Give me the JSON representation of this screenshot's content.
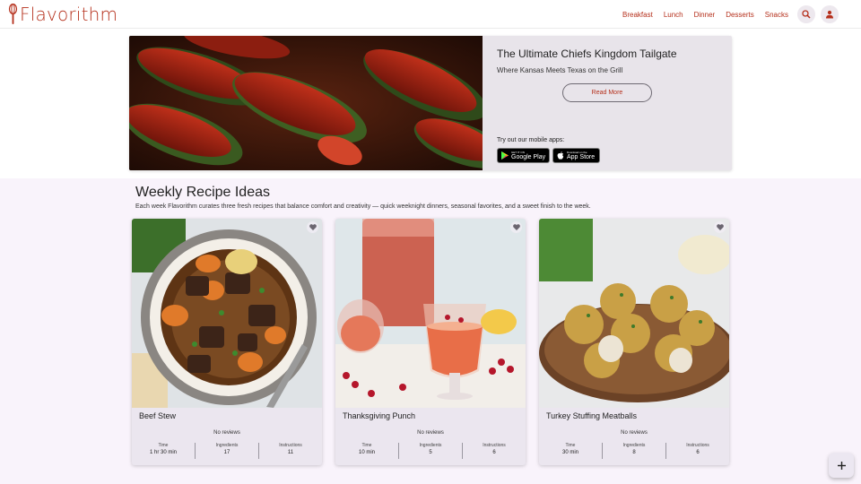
{
  "header": {
    "logo_text": "Flavorithm",
    "nav": [
      "Breakfast",
      "Lunch",
      "Dinner",
      "Desserts",
      "Snacks"
    ],
    "search_icon": "search-icon",
    "account_icon": "person-icon"
  },
  "hero": {
    "title": "The Ultimate Chiefs Kingdom Tailgate",
    "subtitle": "Where Kansas Meets Texas on the Grill",
    "read_more": "Read More",
    "apps_label": "Try out our mobile apps:",
    "google_small": "GET IT ON",
    "google_big": "Google Play",
    "apple_small": "Download on the",
    "apple_big": "App Store"
  },
  "weekly": {
    "title": "Weekly Recipe Ideas",
    "description": "Each week Flavorithm curates three fresh recipes that balance comfort and creativity — quick weeknight dinners, seasonal favorites, and a sweet finish to the week."
  },
  "cards": [
    {
      "title": "Beef Stew",
      "reviews": "No reviews",
      "time_label": "Time",
      "time": "1 hr 30 min",
      "ingredients_label": "Ingredients",
      "ingredients": "17",
      "instructions_label": "Instructions",
      "instructions": "11"
    },
    {
      "title": "Thanksgiving Punch",
      "reviews": "No reviews",
      "time_label": "Time",
      "time": "10 min",
      "ingredients_label": "Ingredients",
      "ingredients": "5",
      "instructions_label": "Instructions",
      "instructions": "6"
    },
    {
      "title": "Turkey Stuffing Meatballs",
      "reviews": "No reviews",
      "time_label": "Time",
      "time": "30 min",
      "ingredients_label": "Ingredients",
      "ingredients": "8",
      "instructions_label": "Instructions",
      "instructions": "6"
    }
  ],
  "colors": {
    "brand": "#b5301c",
    "card_bg": "#ebe6ef",
    "section_bg": "#f9f3fb"
  },
  "fab_icon": "plus-icon"
}
